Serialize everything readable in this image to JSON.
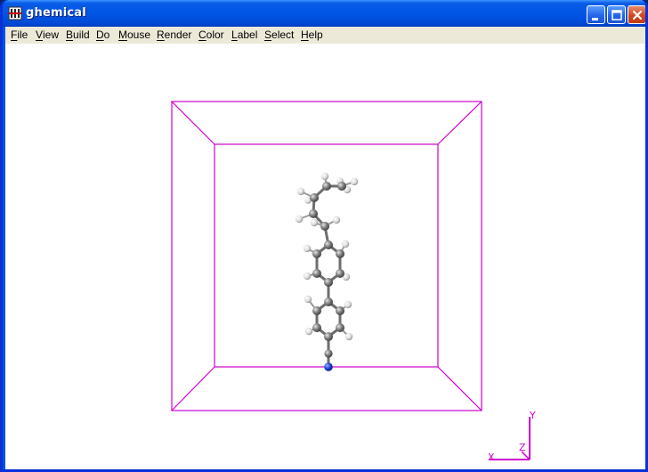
{
  "window": {
    "title": "ghemical",
    "icon": "ghemical-app-icon",
    "controls": [
      "minimize-icon",
      "maximize-icon",
      "close-icon"
    ]
  },
  "menu": {
    "items": [
      {
        "label": "File",
        "mnemonic": "F",
        "rest": "ile"
      },
      {
        "label": "View",
        "mnemonic": "V",
        "rest": "iew"
      },
      {
        "label": "Build",
        "mnemonic": "B",
        "rest": "uild"
      },
      {
        "label": "Do",
        "mnemonic": "D",
        "rest": "o"
      },
      {
        "label": "Mouse",
        "mnemonic": "M",
        "rest": "ouse"
      },
      {
        "label": "Render",
        "mnemonic": "R",
        "rest": "ender"
      },
      {
        "label": "Color",
        "mnemonic": "C",
        "rest": "olor"
      },
      {
        "label": "Label",
        "mnemonic": "L",
        "rest": "abel"
      },
      {
        "label": "Select",
        "mnemonic": "S",
        "rest": "elect"
      },
      {
        "label": "Help",
        "mnemonic": "H",
        "rest": "elp"
      }
    ]
  },
  "viewport": {
    "background": "#ffffff",
    "box_color": "#d000d0",
    "axes": {
      "y": "Y",
      "z": "Z",
      "x": "X"
    },
    "atom_colors": {
      "carbon": "#7a7a7a",
      "hydrogen": "#e8e8e8",
      "nitrogen": "#2046d8"
    }
  }
}
